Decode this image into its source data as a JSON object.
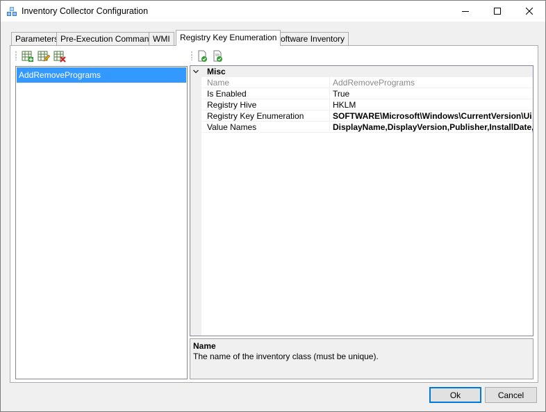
{
  "window": {
    "title": "Inventory Collector Configuration",
    "app_icon": "app-icon",
    "controls": {
      "minimize": "minimize-icon",
      "maximize": "maximize-icon",
      "close": "close-icon"
    }
  },
  "tabs": [
    {
      "label": "Parameters",
      "active": false
    },
    {
      "label": "Pre-Execution Commands",
      "active": false
    },
    {
      "label": "WMI",
      "active": false
    },
    {
      "label": "Registry Key Enumeration",
      "active": true
    },
    {
      "label": "Software Inventory",
      "active": false
    }
  ],
  "left_toolbar": {
    "icons": [
      "add-item-icon",
      "edit-item-icon",
      "delete-item-icon"
    ]
  },
  "list": {
    "items": [
      {
        "label": "AddRemovePrograms",
        "selected": true
      }
    ]
  },
  "grid_toolbar": {
    "icons": [
      "categorized-view-icon",
      "property-pages-icon"
    ]
  },
  "property_grid": {
    "category": "Misc",
    "properties": [
      {
        "name": "Name",
        "value": "AddRemovePrograms",
        "readonly": true,
        "bold": false
      },
      {
        "name": "Is Enabled",
        "value": "True",
        "readonly": false,
        "bold": false
      },
      {
        "name": "Registry Hive",
        "value": "HKLM",
        "readonly": false,
        "bold": false
      },
      {
        "name": "Registry Key Enumeration",
        "value": "SOFTWARE\\Microsoft\\Windows\\CurrentVersion\\Ui",
        "readonly": false,
        "bold": true
      },
      {
        "name": "Value Names",
        "value": "DisplayName,DisplayVersion,Publisher,InstallDate,I",
        "readonly": false,
        "bold": true
      }
    ]
  },
  "help": {
    "title": "Name",
    "description": "The name of the inventory class (must be unique)."
  },
  "buttons": {
    "ok": "Ok",
    "cancel": "Cancel"
  },
  "colors": {
    "selection": "#3399ff",
    "accent": "#0078d7"
  }
}
